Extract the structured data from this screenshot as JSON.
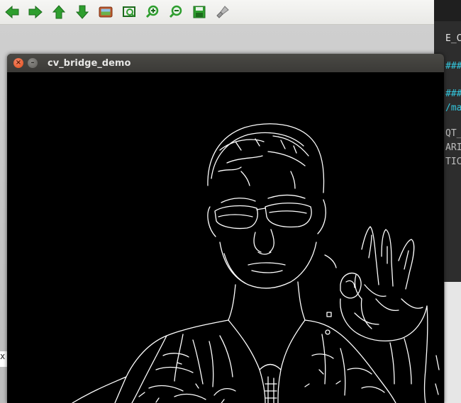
{
  "background_viewer": {
    "toolbar": [
      {
        "name": "back-arrow-icon",
        "color": "#2e9e2e"
      },
      {
        "name": "forward-arrow-icon",
        "color": "#2e9e2e"
      },
      {
        "name": "up-arrow-icon",
        "color": "#2e9e2e"
      },
      {
        "name": "down-arrow-icon",
        "color": "#2e9e2e"
      },
      {
        "name": "image-icon",
        "color": "#c0582c"
      },
      {
        "name": "fit-view-icon",
        "color": "#2e9e2e"
      },
      {
        "name": "zoom-in-icon",
        "color": "#2e9e2e"
      },
      {
        "name": "zoom-out-icon",
        "color": "#2e9e2e"
      },
      {
        "name": "save-icon",
        "color": "#2e9e2e"
      },
      {
        "name": "clear-brush-icon",
        "color": "#8a8a8a"
      }
    ]
  },
  "background_terminal": {
    "lines": [
      {
        "text": "E_CUR",
        "color": "#e6e6e6"
      },
      {
        "text": "###",
        "color": "#33c7de"
      },
      {
        "text": "###",
        "color": "#33c7de"
      },
      {
        "text": "/ma",
        "color": "#33c7de"
      },
      {
        "text": "QT_",
        "color": "#bdbdbd"
      },
      {
        "text": "ARI",
        "color": "#bdbdbd"
      },
      {
        "text": "TIC",
        "color": "#bdbdbd"
      }
    ]
  },
  "left_remnant": {
    "text": "x"
  },
  "window": {
    "title": "cv_bridge_demo",
    "close_glyph": "×",
    "minimize_glyph": "–",
    "canvas_background": "#000000",
    "edge_color": "#ffffff"
  }
}
